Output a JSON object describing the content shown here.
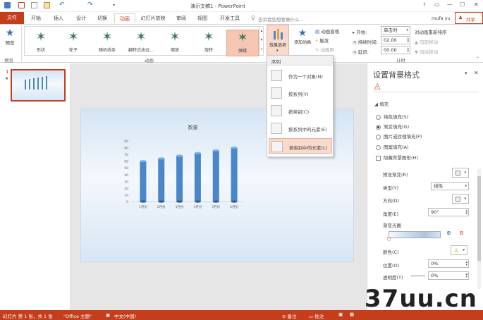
{
  "window": {
    "title": "演示文稿1 - PowerPoint",
    "controls": [
      "?",
      "▭",
      "—",
      "☐",
      "✕"
    ]
  },
  "tabs": [
    {
      "label": "文件"
    },
    {
      "label": "开始"
    },
    {
      "label": "插入"
    },
    {
      "label": "设计"
    },
    {
      "label": "切换"
    },
    {
      "label": "动画"
    },
    {
      "label": "幻灯片放映"
    },
    {
      "label": "审阅"
    },
    {
      "label": "视图"
    },
    {
      "label": "开发工具"
    }
  ],
  "tell_me": "告诉我您想要做什么...",
  "user": {
    "name": "mufa yu",
    "share": "共享"
  },
  "ribbon": {
    "preview_label": "预览",
    "preview_group": "预览",
    "animation_group": "动画",
    "timing_group": "计时",
    "animations": [
      {
        "label": "形状",
        "icon": "star-icon"
      },
      {
        "label": "轮子",
        "icon": "star-icon"
      },
      {
        "label": "随机线条",
        "icon": "star-icon"
      },
      {
        "label": "翻转式由远...",
        "icon": "star-icon"
      },
      {
        "label": "缩放",
        "icon": "star-icon"
      },
      {
        "label": "旋转",
        "icon": "star-icon"
      },
      {
        "label": "弹跳",
        "icon": "star-icon"
      }
    ],
    "effect_options": "效果选项",
    "add_animation": "添加动画",
    "animation_pane": "动画窗格",
    "trigger": "触发",
    "animation_painter": "动画刷",
    "start_label": "开始:",
    "start_value": "单击时",
    "duration_label": "持续时间:",
    "duration_value": "02.00",
    "delay_label": "延迟:",
    "delay_value": "00.00",
    "reorder_title": "对动画重新排序",
    "move_earlier": "向前移动",
    "move_later": "向后移动"
  },
  "effect_menu": {
    "header": "序列",
    "items": [
      {
        "label": "作为一个对象(N)"
      },
      {
        "label": "按系列(Y)"
      },
      {
        "label": "按类别(C)"
      },
      {
        "label": "按系列中的元素(E)"
      },
      {
        "label": "按类别中的元素(L)"
      }
    ]
  },
  "thumbnail": {
    "number": "1",
    "star": "★"
  },
  "chart_data": {
    "type": "bar",
    "title": "数量",
    "categories": [
      "1月份",
      "2月份",
      "3月份",
      "4月份",
      "5月份",
      "6月份"
    ],
    "values": [
      60,
      64,
      68,
      72,
      76,
      80
    ],
    "ylim": [
      0,
      90
    ],
    "yticks": [
      "0",
      "10",
      "20",
      "30",
      "40",
      "50",
      "60",
      "70",
      "80",
      "90"
    ],
    "bar_color": "#4a86c8",
    "grid": false
  },
  "pane": {
    "title": "设置背景格式",
    "section": "填充",
    "fill_options": [
      {
        "label": "纯色填充(S)",
        "checked": false
      },
      {
        "label": "渐变填充(G)",
        "checked": true
      },
      {
        "label": "图片或纹理填充(P)",
        "checked": false
      },
      {
        "label": "图案填充(A)",
        "checked": false
      }
    ],
    "hide_background": "隐藏背景图形(H)",
    "preset_label": "预设渐变(R)",
    "type_label": "类型(Y)",
    "type_value": "线性",
    "direction_label": "方向(D)",
    "angle_label": "角度(E)",
    "angle_value": "90°",
    "stops_label": "渐变光圈",
    "color_label": "颜色(C)",
    "position_label": "位置(O)",
    "position_value": "0%",
    "transparency_label": "透明度(T)",
    "transparency_value": "0%"
  },
  "status": {
    "slide_info": "幻灯片 第 1 张，共 1 张",
    "theme": "\"Office 主题\"",
    "language": "中文(中国)",
    "notes": "备注",
    "comments": "批注"
  },
  "watermark": "37uu.cn",
  "colors": {
    "accent": "#c43e1c",
    "bar": "#4a86c8"
  }
}
